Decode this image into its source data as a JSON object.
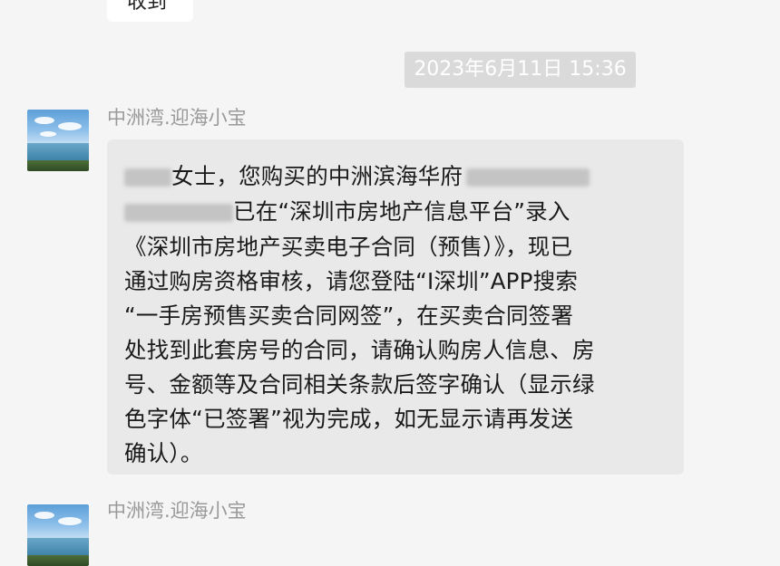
{
  "previous_message": {
    "text": "收到"
  },
  "timestamp": "2023年6月11日 15:36",
  "message": {
    "sender": "中洲湾.迎海小宝",
    "lines": [
      [
        "女士，您购买的中洲滨海华府",
        ""
      ],
      [
        "已在“深圳市房地产信息平台”录入"
      ],
      [
        "《深圳市房地产买卖电子合同（预售）》，现已"
      ],
      [
        "通过购房资格审核，请您登陆“I深圳”APP搜索"
      ],
      [
        " “一手房预售买卖合同网签”，在买卖合同签署"
      ],
      [
        "处找到此套房号的合同，请确认购房人信息、房"
      ],
      [
        "号、金额等及合同相关条款后签字确认（显示绿"
      ],
      [
        "色字体“已签署”视为完成，如无显示请再发送"
      ],
      [
        "确认）。"
      ]
    ]
  },
  "next_message": {
    "sender": "中洲湾.迎海小宝"
  },
  "colors": {
    "background": "#f5f5f5",
    "bubble": "#e9e9e9",
    "timestamp_bg": "#dadada",
    "sender_text": "#9a9a9a"
  }
}
